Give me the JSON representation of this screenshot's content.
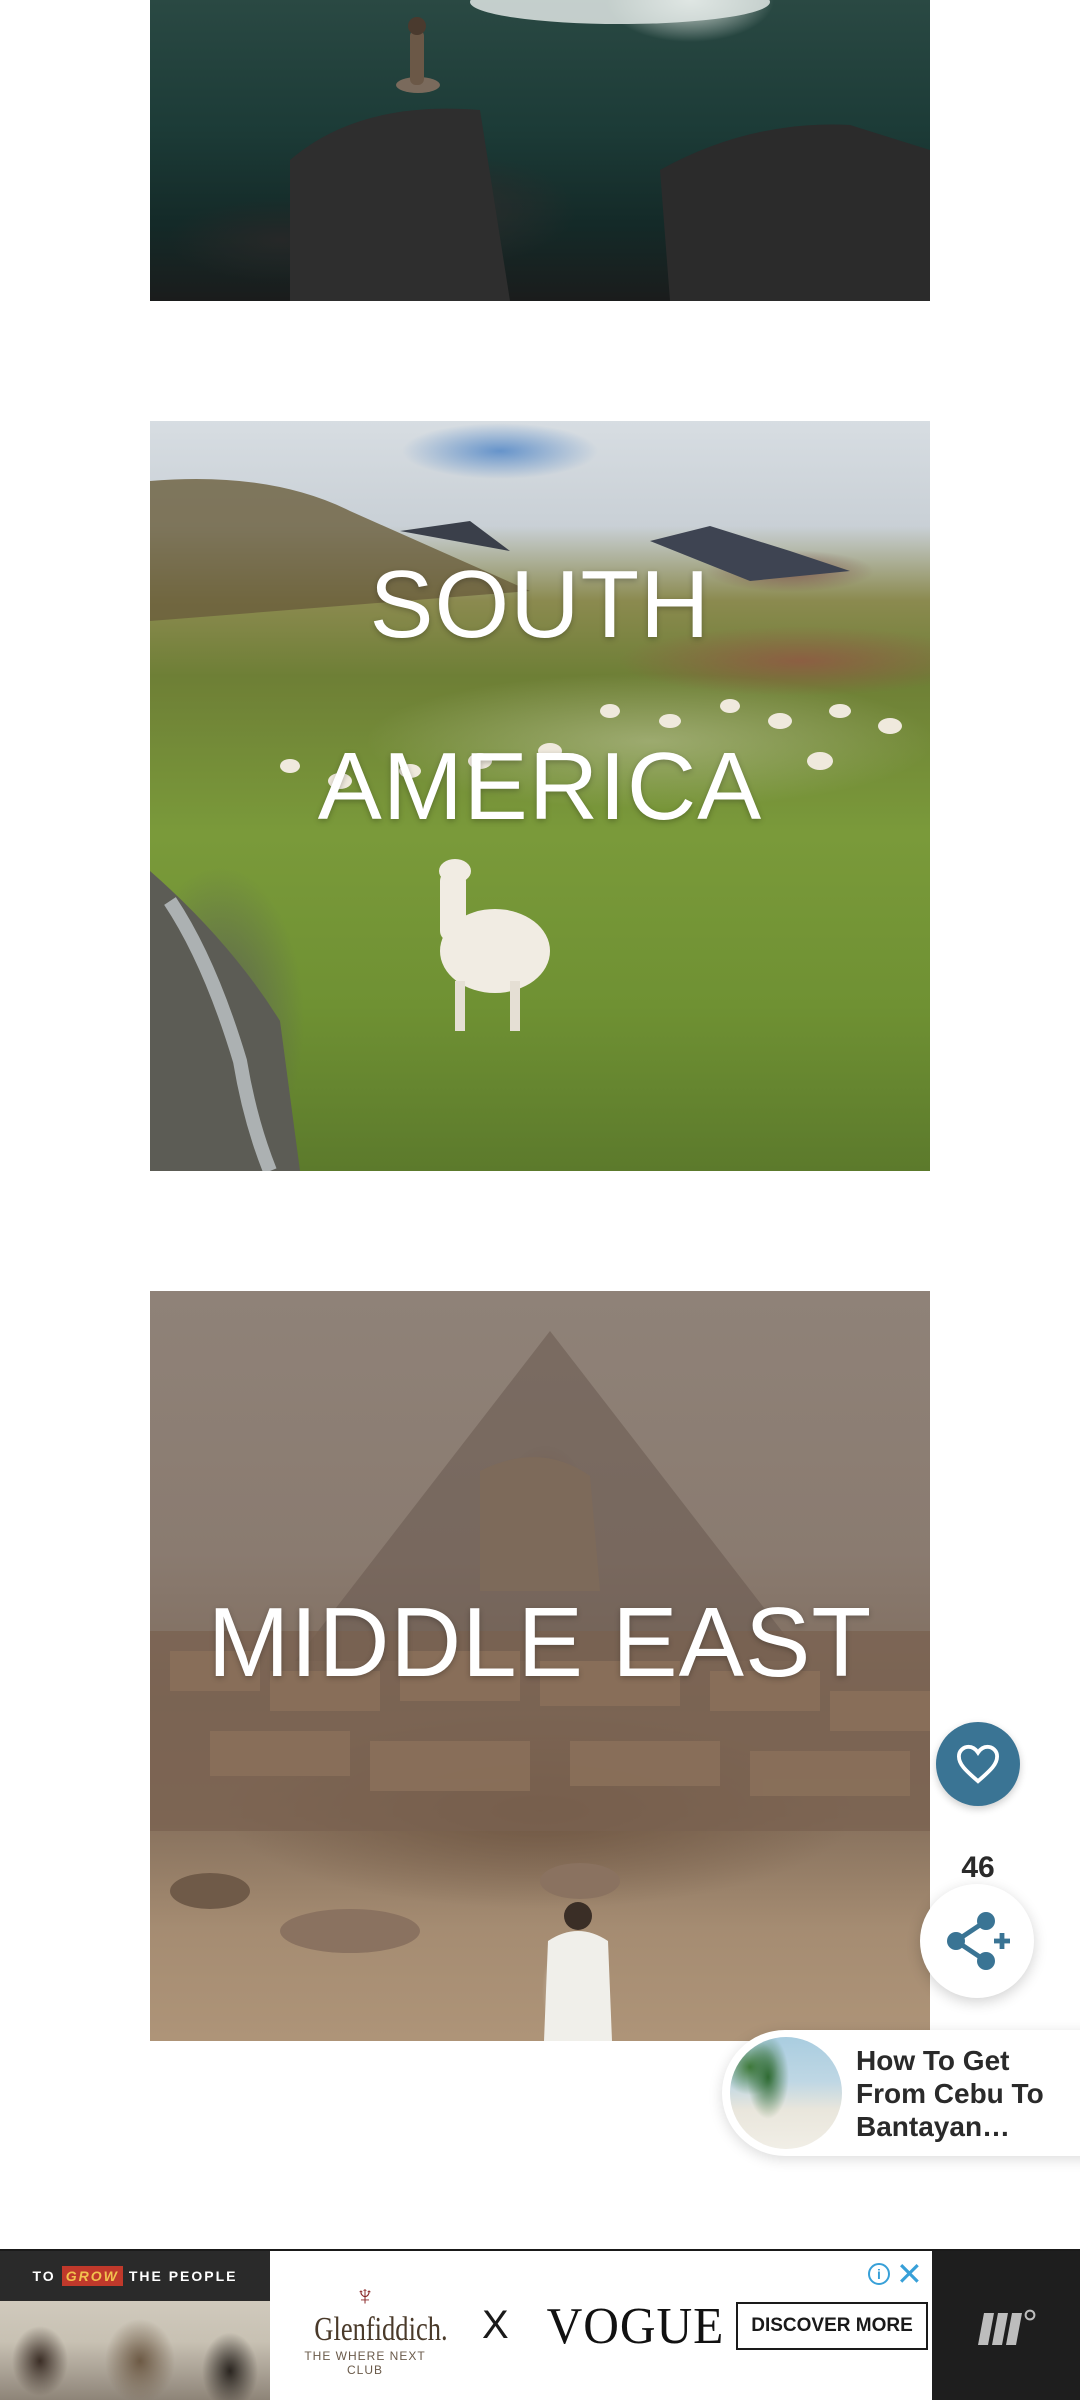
{
  "regions": [
    {
      "id": "top",
      "label": ""
    },
    {
      "id": "south-america",
      "label": "SOUTH AMERICA"
    },
    {
      "id": "middle-east",
      "label": "MIDDLE EAST"
    }
  ],
  "floating": {
    "like_icon": "heart-icon",
    "like_count": "46",
    "share_icon": "share-plus-icon",
    "accent_color": "#3a7494"
  },
  "related": {
    "title": "How To Get\nFrom Cebu To\nBantayan…"
  },
  "ad": {
    "tagline_pre": "TO",
    "tagline_grow": "GROW",
    "tagline_post": "THE PEOPLE",
    "brand": "Glenfiddich.",
    "brand_sub": "THE WHERE NEXT CLUB",
    "separator": "X",
    "partner": "VOGUE",
    "cta": "DISCOVER MORE",
    "info_icon": "info-icon",
    "close_icon": "close-icon"
  }
}
